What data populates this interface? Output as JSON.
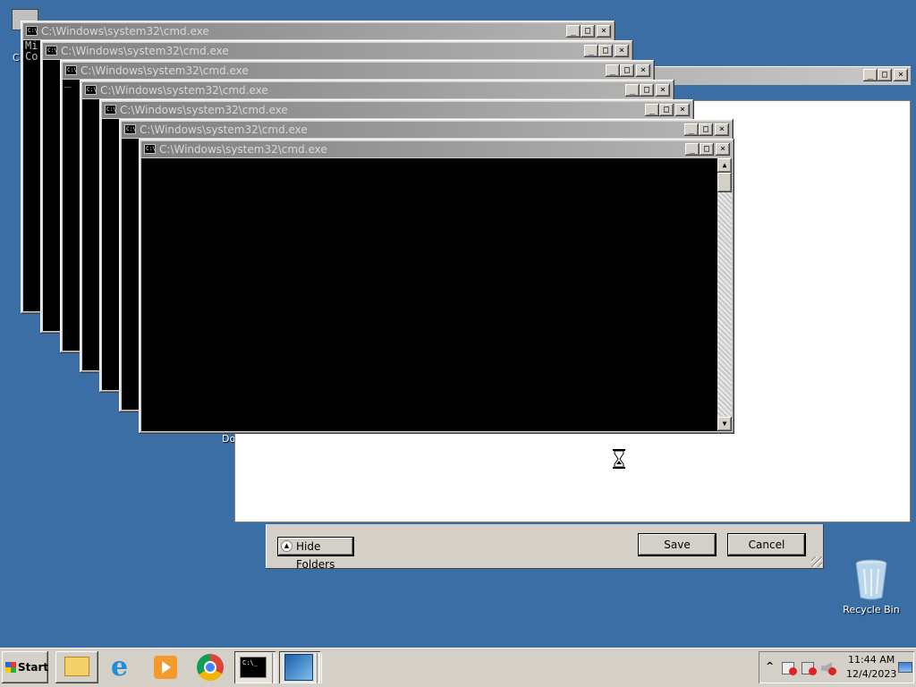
{
  "desktop": {
    "top_left_icon_label": "C",
    "bottom_icon_label_fragment": "Do",
    "recycle_bin_label": "Recycle Bin"
  },
  "cmd_windows": {
    "title": "C:\\Windows\\system32\\cmd.exe",
    "window1_text_line1": "Mi",
    "window1_text_line2": "Co",
    "window3_cursor": "_"
  },
  "window_controls": {
    "minimize": "_",
    "maximize": "□",
    "close": "×"
  },
  "scroll_arrows": {
    "up": "▲",
    "down": "▼"
  },
  "save_dialog": {
    "hide_folders_label": "Hide Folders",
    "save_label": "Save",
    "cancel_label": "Cancel"
  },
  "taskbar": {
    "start_label": "Start",
    "time": "11:44 AM",
    "date": "12/4/2023",
    "tray_chevron": "^"
  },
  "colors": {
    "desktop": "#3a6ea5",
    "console_bg": "#000000",
    "inactive_title_start": "#808080",
    "inactive_title_end": "#b5b5b5"
  }
}
